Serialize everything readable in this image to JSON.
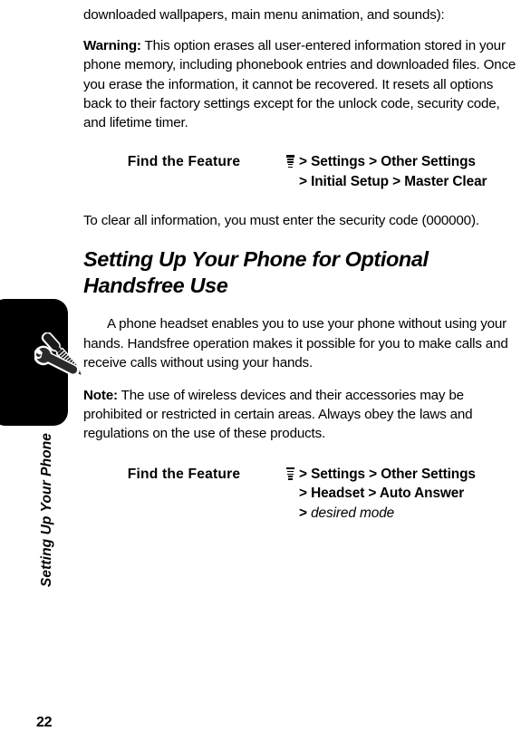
{
  "document": {
    "page_number": "22",
    "running_head": "Setting Up Your Phone"
  },
  "icons": {
    "side_tab": "wrench-screwdriver-icon",
    "menu": "menu-stack-icon"
  },
  "content": {
    "paragraph_continuation": "downloaded wallpapers, main menu animation, and sounds):",
    "warning": {
      "lead": "Warning:",
      "text": " This option erases all user-entered information stored in your phone memory, including phonebook entries and downloaded files. Once you erase the information, it cannot be recovered. It resets all options back to their factory settings except for the unlock code, security code, and lifetime timer."
    },
    "find_feature_1": {
      "label": "Find the Feature",
      "line1": "> Settings > Other Settings",
      "line2": "> Initial Setup > Master Clear"
    },
    "clear_info": "To clear all information, you must enter the security code (000000).",
    "heading": "Setting Up Your Phone for Optional Handsfree Use",
    "handsfree_intro": "A phone headset enables you to use your phone without using your hands. Handsfree operation makes it possible for you to make calls and receive calls without using your hands.",
    "note": {
      "lead": "Note:",
      "text": " The use of wireless devices and their accessories may be prohibited or restricted in certain areas. Always obey the laws and regulations on the use of these products."
    },
    "find_feature_2": {
      "label": "Find the Feature",
      "line1": "> Settings > Other Settings",
      "line2": "> Headset  > Auto Answer",
      "line3_prefix": "> ",
      "line3_italic": "desired mode"
    }
  },
  "colors": {
    "ink": "#000000",
    "paper": "#ffffff",
    "tab": "#000000"
  }
}
